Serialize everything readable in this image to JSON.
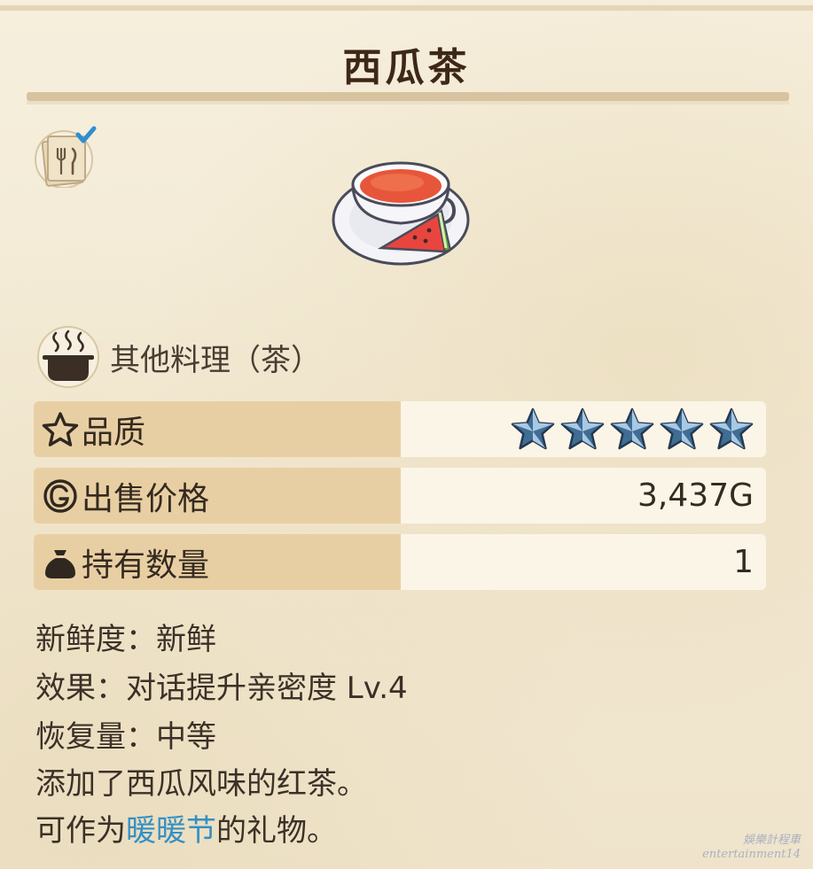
{
  "item": {
    "name": "西瓜茶",
    "category": "其他料理（茶）"
  },
  "stats": {
    "quality_label": "品质",
    "quality_stars": 5,
    "quality_max_stars": 5,
    "price_label": "出售价格",
    "price_value": "3,437G",
    "owned_label": "持有数量",
    "owned_value": "1"
  },
  "details": {
    "freshness": "新鲜度：新鲜",
    "effect": "效果：对话提升亲密度 Lv.4",
    "recovery": "恢复量：中等",
    "description": "添加了西瓜风味的红茶。",
    "gift_prefix": "可作为",
    "gift_festival": "暖暖节",
    "gift_suffix": "的礼物。"
  },
  "icons": {
    "menu": "menu-recipe-icon",
    "dish": "watermelon-tea-icon",
    "category": "cooking-pot-icon",
    "quality": "star-outline-icon",
    "price": "gold-coin-icon",
    "owned": "bag-icon",
    "rating": "blue-star-icon"
  },
  "colors": {
    "label_bg": "#e8cfa3",
    "value_bg": "#fbf5e8",
    "title": "#3d2818",
    "highlight": "#3590c4"
  },
  "watermark": {
    "line1": "娛樂計程車",
    "line2": "entertainment14"
  }
}
